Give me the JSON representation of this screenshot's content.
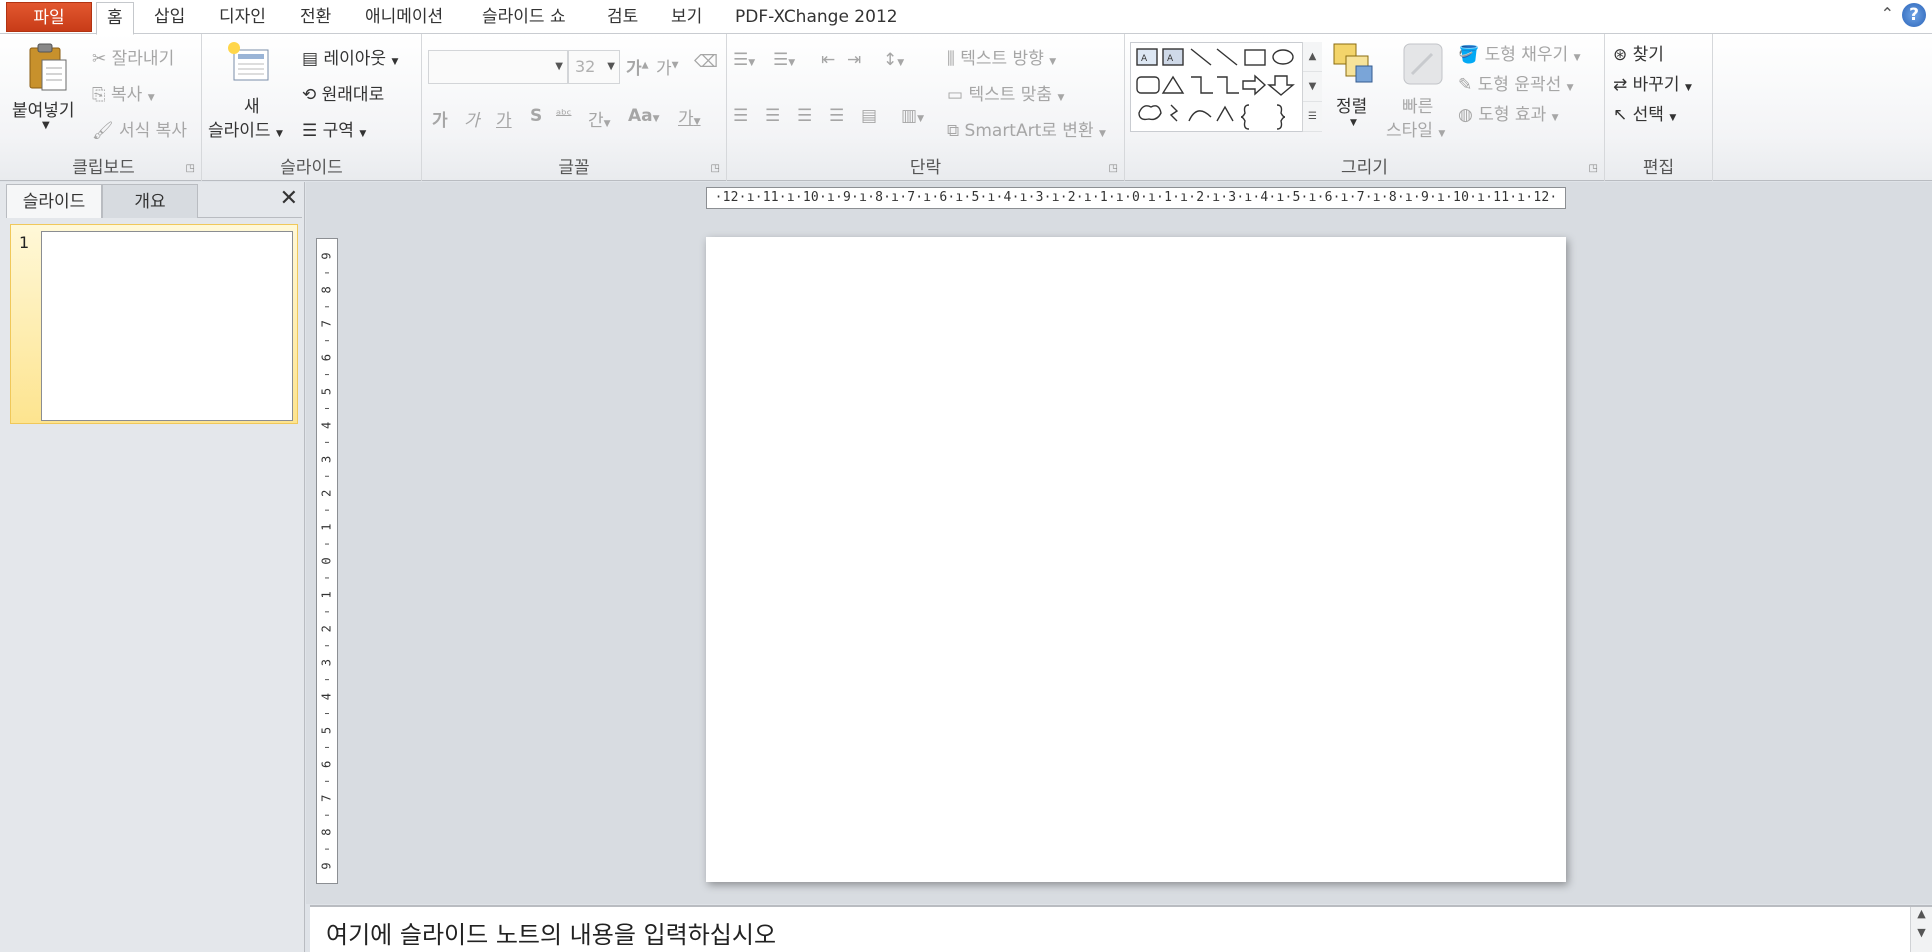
{
  "tabs": {
    "file": "파일",
    "home": "홈",
    "insert": "삽입",
    "design": "디자인",
    "transitions": "전환",
    "animations": "애니메이션",
    "slideshow": "슬라이드 쇼",
    "review": "검토",
    "view": "보기",
    "pdfx": "PDF-XChange 2012"
  },
  "clipboard": {
    "paste": "붙여넣기",
    "cut": "잘라내기",
    "copy": "복사",
    "format_painter": "서식 복사",
    "label": "클립보드"
  },
  "slides_group": {
    "new_slide_1": "새",
    "new_slide_2": "슬라이드",
    "layout": "레이아웃",
    "reset": "원래대로",
    "section": "구역",
    "label": "슬라이드"
  },
  "font": {
    "font_name": "",
    "font_size": "32",
    "grow": "가",
    "shrink": "가",
    "bold": "가",
    "italic": "가",
    "underline": "가",
    "shadow": "S",
    "strike": "ᵃᵇᶜ",
    "spacing": "간",
    "case": "Aa",
    "color": "가",
    "label": "글꼴"
  },
  "paragraph": {
    "text_direction": "텍스트 방향",
    "align_text": "텍스트 맞춤",
    "smartart": "SmartArt로 변환",
    "label": "단락"
  },
  "drawing": {
    "arrange": "정렬",
    "quick_styles_1": "빠른",
    "quick_styles_2": "스타일",
    "shape_fill": "도형 채우기",
    "shape_outline": "도형 윤곽선",
    "shape_effects": "도형 효과",
    "label": "그리기"
  },
  "editing": {
    "find": "찾기",
    "replace": "바꾸기",
    "select": "선택",
    "label": "편집"
  },
  "leftpane": {
    "tab_slides": "슬라이드",
    "tab_outline": "개요",
    "slide_number": "1"
  },
  "rulers": {
    "horizontal": "·12·ı·11·ı·10·ı·9·ı·8·ı·7·ı·6·ı·5·ı·4·ı·3·ı·2·ı·1·ı·0·ı·1·ı·2·ı·3·ı·4·ı·5·ı·6·ı·7·ı·8·ı·9·ı·10·ı·11·ı·12·",
    "vertical_labels": [
      "9",
      "8",
      "7",
      "6",
      "5",
      "4",
      "3",
      "2",
      "1",
      "0",
      "1",
      "2",
      "3",
      "4",
      "5",
      "6",
      "7",
      "8",
      "9"
    ]
  },
  "notes": {
    "placeholder": "여기에 슬라이드 노트의 내용을 입력하십시오"
  },
  "colors": {
    "file_tab": "#d24726",
    "selection_highlight": "#fde48f"
  }
}
